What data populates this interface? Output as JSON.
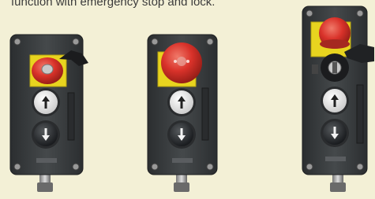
{
  "caption": "function with emergency stop and lock.",
  "colors": {
    "background": "#f3f0d6",
    "housing": "#3a3d3f",
    "yellow_plate": "#e8d41f",
    "red_button": "#d9322a",
    "white_button": "#f2f2f2",
    "black_button": "#1f2124"
  },
  "pendants": [
    {
      "name": "pendant-1",
      "controls": [
        "emergency-stop-with-lock",
        "up-arrow-button",
        "down-arrow-button"
      ]
    },
    {
      "name": "pendant-2",
      "controls": [
        "emergency-stop",
        "up-arrow-button",
        "down-arrow-button"
      ]
    },
    {
      "name": "pendant-3",
      "controls": [
        "emergency-stop",
        "key-switch",
        "up-arrow-button",
        "down-arrow-button"
      ]
    }
  ]
}
